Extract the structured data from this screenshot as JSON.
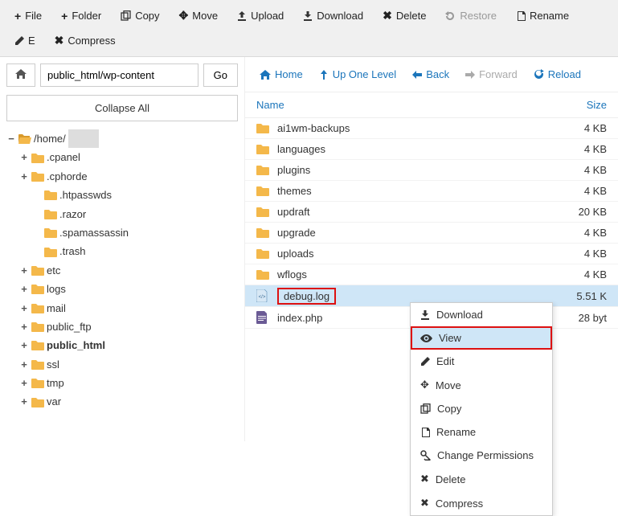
{
  "toolbar": [
    {
      "icon": "plus",
      "label": "File",
      "name": "tb-file",
      "i": true
    },
    {
      "icon": "plus",
      "label": "Folder",
      "name": "tb-folder",
      "i": true
    },
    {
      "icon": "copy",
      "label": "Copy",
      "name": "tb-copy",
      "i": true
    },
    {
      "icon": "move",
      "label": "Move",
      "name": "tb-move",
      "i": true
    },
    {
      "icon": "upload",
      "label": "Upload",
      "name": "tb-upload",
      "i": true
    },
    {
      "icon": "download",
      "label": "Download",
      "name": "tb-download",
      "i": true
    },
    {
      "icon": "x",
      "label": "Delete",
      "name": "tb-delete",
      "i": true
    },
    {
      "icon": "restore",
      "label": "Restore",
      "name": "tb-restore",
      "i": false
    },
    {
      "icon": "rename",
      "label": "Rename",
      "name": "tb-rename",
      "i": true
    },
    {
      "icon": "edit",
      "label": "E",
      "name": "tb-edit",
      "i": true
    },
    {
      "icon": "compress",
      "label": "Compress",
      "name": "tb-compress",
      "i": true
    }
  ],
  "path": {
    "value": "public_html/wp-content",
    "go": "Go"
  },
  "collapse": "Collapse All",
  "tree": [
    {
      "tog": "−",
      "fic": "folder-open",
      "label": "/home/",
      "redact": true,
      "ind": 0,
      "bold": false
    },
    {
      "tog": "+",
      "fic": "folder",
      "label": ".cpanel",
      "ind": 1
    },
    {
      "tog": "+",
      "fic": "folder",
      "label": ".cphorde",
      "ind": 1
    },
    {
      "tog": "",
      "fic": "folder",
      "label": ".htpasswds",
      "ind": 2
    },
    {
      "tog": "",
      "fic": "folder",
      "label": ".razor",
      "ind": 2
    },
    {
      "tog": "",
      "fic": "folder",
      "label": ".spamassassin",
      "ind": 2
    },
    {
      "tog": "",
      "fic": "folder",
      "label": ".trash",
      "ind": 2
    },
    {
      "tog": "+",
      "fic": "folder",
      "label": "etc",
      "ind": 1
    },
    {
      "tog": "+",
      "fic": "folder",
      "label": "logs",
      "ind": 1
    },
    {
      "tog": "+",
      "fic": "folder",
      "label": "mail",
      "ind": 1
    },
    {
      "tog": "+",
      "fic": "folder",
      "label": "public_ftp",
      "ind": 1
    },
    {
      "tog": "+",
      "fic": "folder",
      "label": "public_html",
      "ind": 1,
      "bold": true
    },
    {
      "tog": "+",
      "fic": "folder",
      "label": "ssl",
      "ind": 1
    },
    {
      "tog": "+",
      "fic": "folder",
      "label": "tmp",
      "ind": 1
    },
    {
      "tog": "+",
      "fic": "folder",
      "label": "var",
      "ind": 1
    }
  ],
  "nav": [
    {
      "icon": "home",
      "label": "Home",
      "name": "nav-home",
      "i": true
    },
    {
      "icon": "up",
      "label": "Up One Level",
      "name": "nav-up",
      "i": true
    },
    {
      "icon": "back",
      "label": "Back",
      "name": "nav-back",
      "i": true
    },
    {
      "icon": "fwd",
      "label": "Forward",
      "name": "nav-forward",
      "i": false
    },
    {
      "icon": "reload",
      "label": "Reload",
      "name": "nav-reload",
      "i": true
    }
  ],
  "headers": {
    "name": "Name",
    "size": "Size"
  },
  "files": [
    {
      "icon": "folder",
      "name": "ai1wm-backups",
      "size": "4 KB"
    },
    {
      "icon": "folder",
      "name": "languages",
      "size": "4 KB"
    },
    {
      "icon": "folder",
      "name": "plugins",
      "size": "4 KB"
    },
    {
      "icon": "folder",
      "name": "themes",
      "size": "4 KB"
    },
    {
      "icon": "folder",
      "name": "updraft",
      "size": "20 KB"
    },
    {
      "icon": "folder",
      "name": "upgrade",
      "size": "4 KB"
    },
    {
      "icon": "folder",
      "name": "uploads",
      "size": "4 KB"
    },
    {
      "icon": "folder",
      "name": "wflogs",
      "size": "4 KB"
    },
    {
      "icon": "code",
      "name": "debug.log",
      "size": "5.51 K",
      "sel": true,
      "hl": true
    },
    {
      "icon": "php",
      "name": "index.php",
      "size": "28 byt"
    }
  ],
  "context": [
    {
      "icon": "download",
      "label": "Download"
    },
    {
      "icon": "eye",
      "label": "View",
      "hl": true
    },
    {
      "icon": "edit",
      "label": "Edit"
    },
    {
      "icon": "move",
      "label": "Move"
    },
    {
      "icon": "copy",
      "label": "Copy"
    },
    {
      "icon": "rename",
      "label": "Rename"
    },
    {
      "icon": "key",
      "label": "Change Permissions"
    },
    {
      "icon": "x",
      "label": "Delete"
    },
    {
      "icon": "compress",
      "label": "Compress"
    }
  ]
}
